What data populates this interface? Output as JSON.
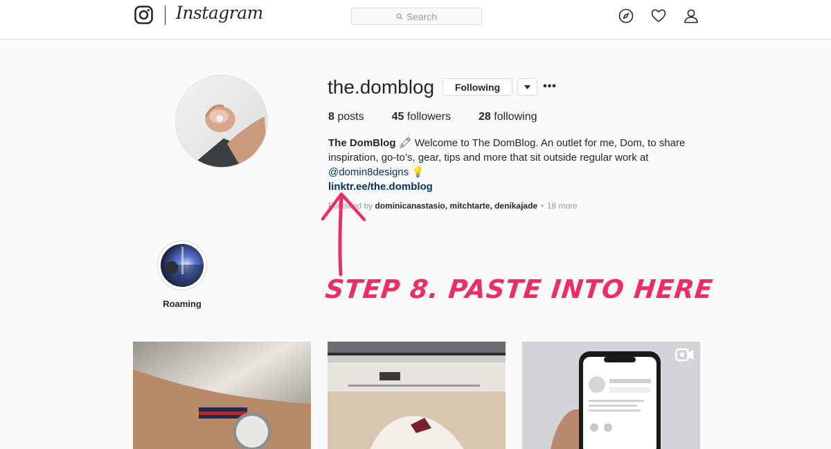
{
  "header": {
    "wordmark": "Instagram",
    "search_placeholder": "Search",
    "icons": [
      "instagram-glyph-icon",
      "compass-icon",
      "heart-icon",
      "user-icon"
    ]
  },
  "profile": {
    "username": "the.domblog",
    "follow_label": "Following",
    "more_label": "•••",
    "stats": {
      "posts_count": "8",
      "posts_label": "posts",
      "followers_count": "45",
      "followers_label": "followers",
      "following_count": "28",
      "following_label": "following"
    },
    "bio": {
      "name": "The DomBlog",
      "emoji1": "🖍",
      "text": "Welcome to The DomBlog. An outlet for me, Dom, to share inspiration, go-to’s, gear, tips and more that sit outside regular work at",
      "mention": "@domin8designs",
      "emoji2": "💡",
      "link": "linktr.ee/the.domblog"
    },
    "followed_by": {
      "prefix": "Followed by",
      "users": "dominicanastasio, mitchtarte, denikajade",
      "more": "+ 18 more"
    }
  },
  "highlight": {
    "label": "Roaming"
  },
  "annotation": {
    "text": "STEP 8. PASTE INTO HERE",
    "color": "#ee2d62"
  },
  "colors": {
    "link": "#003569",
    "border": "#dbdbdb",
    "text": "#262626",
    "muted": "#999999"
  }
}
